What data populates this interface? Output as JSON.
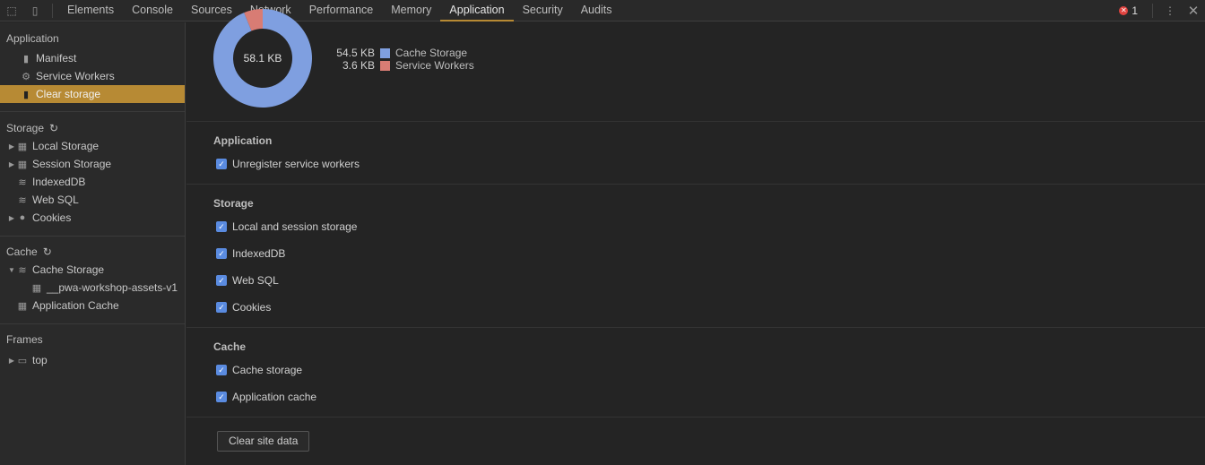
{
  "toolbar": {
    "tabs": [
      "Elements",
      "Console",
      "Sources",
      "Network",
      "Performance",
      "Memory",
      "Application",
      "Security",
      "Audits"
    ],
    "active": "Application",
    "error_count": "1"
  },
  "sidebar": {
    "application": {
      "title": "Application",
      "items": [
        "Manifest",
        "Service Workers",
        "Clear storage"
      ],
      "selected": "Clear storage"
    },
    "storage": {
      "title": "Storage",
      "items": [
        "Local Storage",
        "Session Storage",
        "IndexedDB",
        "Web SQL",
        "Cookies"
      ]
    },
    "cache": {
      "title": "Cache",
      "items": [
        "Cache Storage",
        "__pwa-workshop-assets-v1",
        "Application Cache"
      ]
    },
    "frames": {
      "title": "Frames",
      "items": [
        "top"
      ]
    }
  },
  "usage": {
    "total": "58.1 KB",
    "legend": [
      {
        "value": "54.5 KB",
        "label": "Cache Storage",
        "color": "#7f9fe0",
        "kb": 54.5
      },
      {
        "value": "3.6 KB",
        "label": "Service Workers",
        "color": "#d87c74",
        "kb": 3.6
      }
    ]
  },
  "sections": {
    "application": {
      "title": "Application",
      "options": [
        "Unregister service workers"
      ]
    },
    "storage": {
      "title": "Storage",
      "options": [
        "Local and session storage",
        "IndexedDB",
        "Web SQL",
        "Cookies"
      ]
    },
    "cache": {
      "title": "Cache",
      "options": [
        "Cache storage",
        "Application cache"
      ]
    }
  },
  "clear_button": "Clear site data",
  "accent": "#b78a34"
}
